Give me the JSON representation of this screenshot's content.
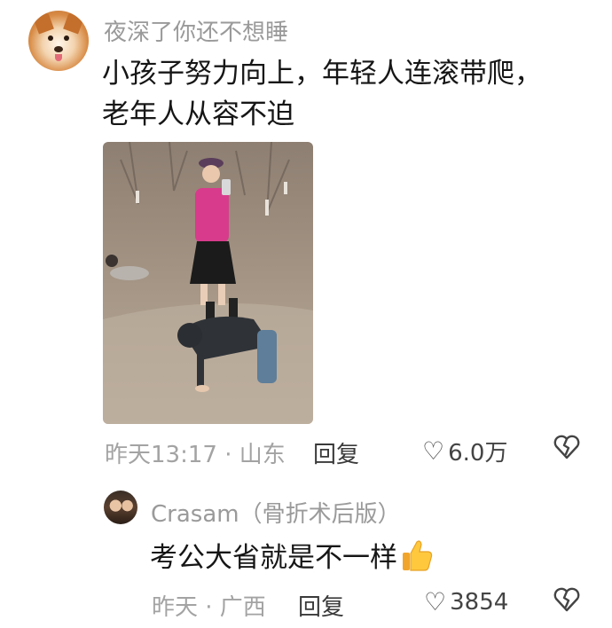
{
  "main_comment": {
    "username": "夜深了你还不想睡",
    "text_line1": "小孩子努力向上，年轻人连滚带爬，",
    "text_line2": "老年人从容不迫",
    "meta": "昨天13:17 · 山东",
    "reply_label": "回复",
    "like_count": "6.0万",
    "like_icon": "heart-outline-icon",
    "dislike_icon": "broken-heart-icon"
  },
  "reply_comment": {
    "username": "Crasam（骨折术后版）",
    "text": "考公大省就是不一样",
    "emoji_icon": "thumbs-up-icon",
    "meta": "昨天 · 广西",
    "reply_label": "回复",
    "like_count": "3854",
    "like_icon": "heart-outline-icon",
    "dislike_icon": "broken-heart-icon"
  }
}
